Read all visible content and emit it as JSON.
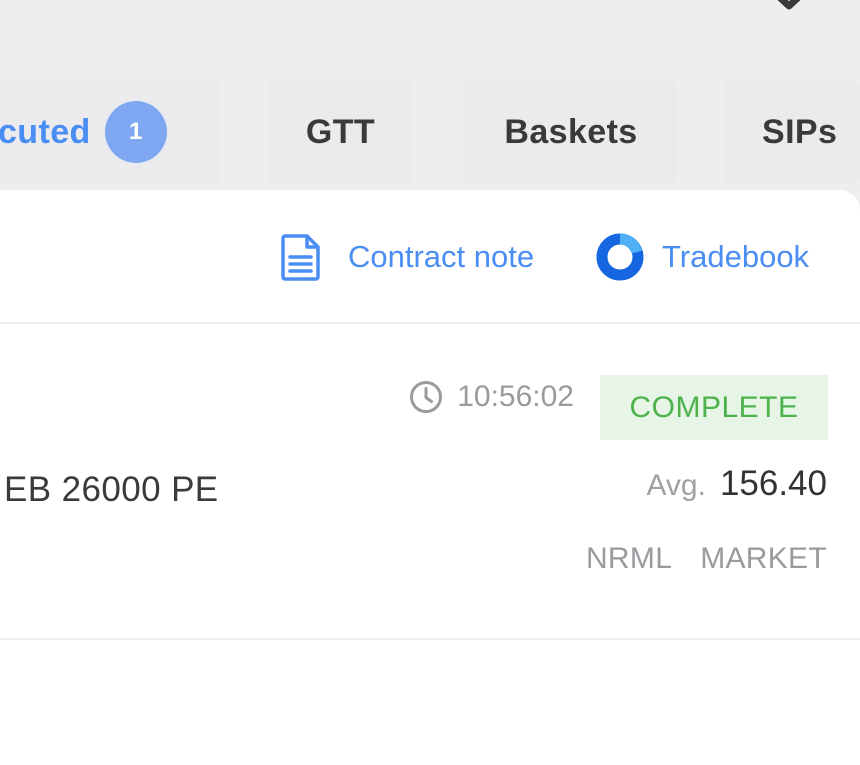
{
  "tabs": [
    {
      "label": "cuted",
      "count": "1",
      "active": true
    },
    {
      "label": "GTT",
      "active": false
    },
    {
      "label": "Baskets",
      "active": false
    },
    {
      "label": "SIPs",
      "active": false
    }
  ],
  "actions": {
    "contract_note": {
      "label": "Contract note",
      "icon": "document-icon"
    },
    "tradebook": {
      "label": "Tradebook",
      "icon": "donut-icon"
    }
  },
  "order": {
    "time": "10:56:02",
    "status": "COMPLETE",
    "instrument": "EB 26000 PE",
    "avg_label": "Avg.",
    "avg_price": "156.40",
    "product": "NRML",
    "order_type": "MARKET"
  },
  "colors": {
    "accent": "#4a8ef4",
    "badge": "#7ea8f2",
    "status_bg": "#e6f5e5",
    "status_text": "#4db24b",
    "tradebook_icon": "#1566e0",
    "background": "#eeeef0"
  }
}
